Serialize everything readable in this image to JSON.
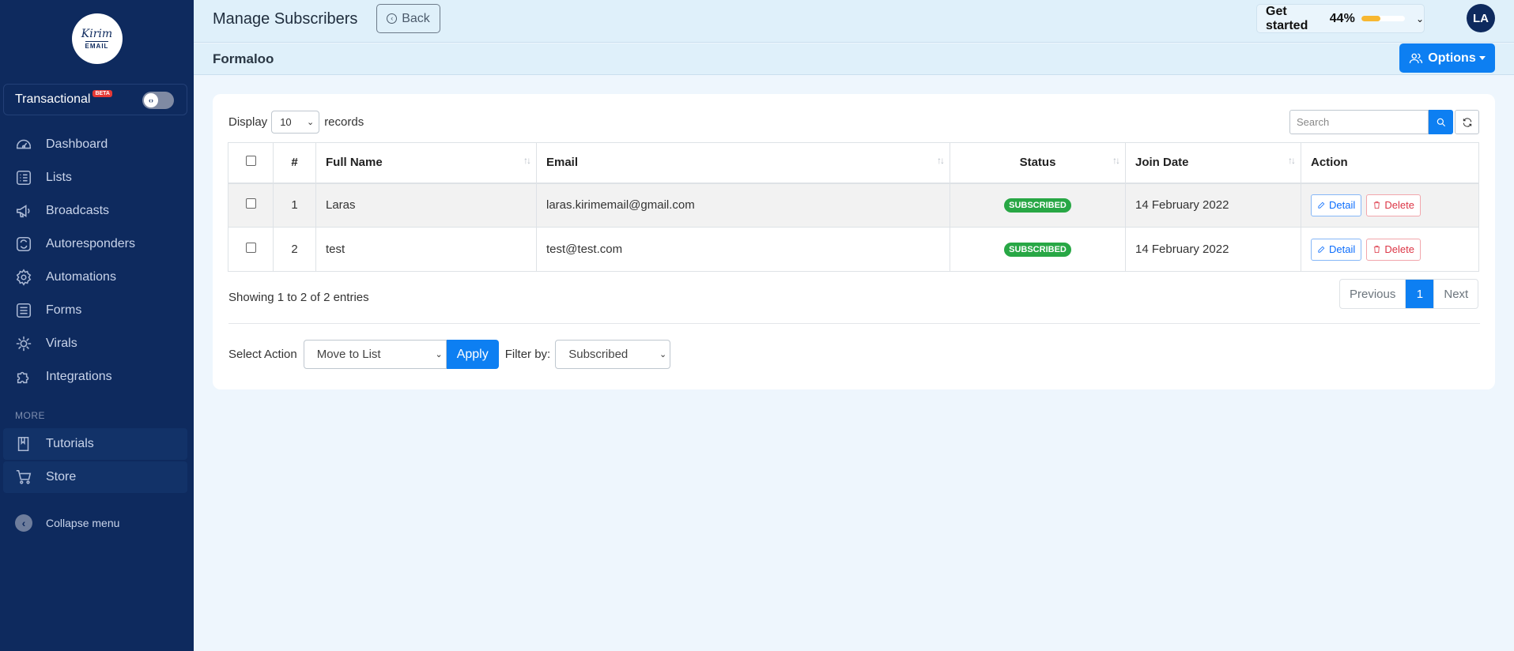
{
  "sidebar": {
    "logo_line1": "Kirim",
    "logo_line2": "EMAIL",
    "transactional_label": "Transactional",
    "beta_badge": "BETA",
    "items": [
      {
        "label": "Dashboard",
        "icon": "dashboard-icon"
      },
      {
        "label": "Lists",
        "icon": "list-icon"
      },
      {
        "label": "Broadcasts",
        "icon": "megaphone-icon"
      },
      {
        "label": "Autoresponders",
        "icon": "autoresponder-icon"
      },
      {
        "label": "Automations",
        "icon": "gear-icon"
      },
      {
        "label": "Forms",
        "icon": "form-icon"
      },
      {
        "label": "Virals",
        "icon": "viral-icon"
      },
      {
        "label": "Integrations",
        "icon": "puzzle-icon"
      }
    ],
    "more_label": "MORE",
    "more_items": [
      {
        "label": "Tutorials",
        "icon": "book-icon"
      },
      {
        "label": "Store",
        "icon": "cart-icon"
      }
    ],
    "collapse_label": "Collapse menu"
  },
  "header": {
    "title": "Manage Subscribers",
    "back_label": "Back",
    "get_started_label": "Get started",
    "get_started_percent": "44%",
    "progress": 0.44,
    "avatar_initials": "LA"
  },
  "subheader": {
    "title": "Formaloo",
    "options_label": "Options"
  },
  "table_controls": {
    "display_label": "Display",
    "page_size": "10",
    "records_label": "records",
    "search_placeholder": "Search"
  },
  "table": {
    "columns": [
      "#",
      "Full Name",
      "Email",
      "Status",
      "Join Date",
      "Action"
    ],
    "rows": [
      {
        "num": "1",
        "name": "Laras",
        "email": "laras.kirimemail@gmail.com",
        "status": "SUBSCRIBED",
        "join_date": "14 February 2022"
      },
      {
        "num": "2",
        "name": "test",
        "email": "test@test.com",
        "status": "SUBSCRIBED",
        "join_date": "14 February 2022"
      }
    ],
    "detail_label": "Detail",
    "delete_label": "Delete"
  },
  "footer": {
    "showing_text": "Showing 1 to 2 of 2 entries",
    "prev_label": "Previous",
    "current_page": "1",
    "next_label": "Next",
    "select_action_label": "Select Action",
    "select_action_value": "Move to List",
    "apply_label": "Apply",
    "filter_label": "Filter by:",
    "filter_value": "Subscribed"
  },
  "colors": {
    "sidebar_bg": "#0e2a5e",
    "accent": "#0d7ff2",
    "status_green": "#28a745",
    "progress_fill": "#f7b731"
  }
}
